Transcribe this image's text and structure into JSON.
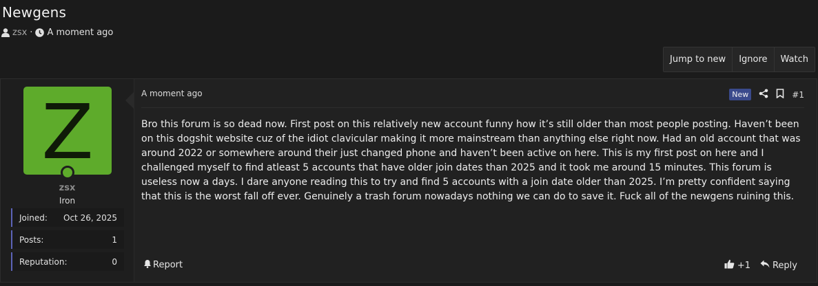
{
  "thread": {
    "title": "Newgens",
    "author": "zsx",
    "separator": "·",
    "time": "A moment ago"
  },
  "actions": [
    "Jump to new",
    "Ignore",
    "Watch"
  ],
  "user": {
    "avatar_letter": "Z",
    "avatar_color": "#5eab2b",
    "name": "zsx",
    "rank": "Iron",
    "stats": [
      {
        "label": "Joined:",
        "value": "Oct 26, 2025"
      },
      {
        "label": "Posts:",
        "value": "1"
      },
      {
        "label": "Reputation:",
        "value": "0"
      }
    ]
  },
  "post": {
    "date": "A moment ago",
    "new_badge": "New",
    "number": "#1",
    "body": "Bro this forum is so dead now. First post on this relatively new account funny how it’s still older than most people posting. Haven’t been on this dogshit website cuz of the idiot clavicular making it more mainstream than anything else right now. Had an old account that was around 2022 or somewhere around their just changed phone and haven’t been active on here. This is my first post on here and I challenged myself to find atleast 5 accounts that have older join dates than 2025 and it took me around 15 minutes. This forum is useless now a days. I dare anyone reading this to try and find 5 accounts with a join date older than 2025. I’m pretty confident saying that this is the worst fall off ever. Genuinely a trash forum nowadays nothing we can do to save it. Fuck all of the newgens ruining this.",
    "report_label": "Report",
    "likes": "+1",
    "reply_label": "Reply"
  },
  "colors": {
    "accent": "#5c63b8",
    "badge_bg": "#3a4a8c"
  },
  "icons": [
    "user-icon",
    "clock-icon",
    "share-icon",
    "bookmark-icon",
    "bell-icon",
    "thumbs-up-icon",
    "reply-icon"
  ]
}
